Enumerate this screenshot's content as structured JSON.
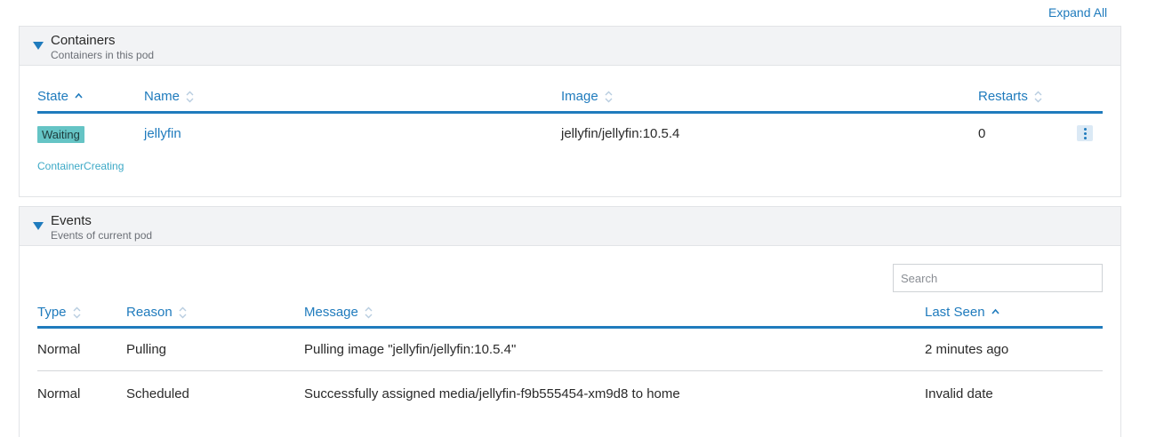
{
  "expand_all_label": "Expand All",
  "containers": {
    "title": "Containers",
    "subtitle": "Containers in this pod",
    "columns": [
      "State",
      "Name",
      "Image",
      "Restarts"
    ],
    "rows": [
      {
        "state": "Waiting",
        "state_reason": "ContainerCreating",
        "name": "jellyfin",
        "image": "jellyfin/jellyfin:10.5.4",
        "restarts": "0"
      }
    ]
  },
  "events": {
    "title": "Events",
    "subtitle": "Events of current pod",
    "search": {
      "placeholder": "Search",
      "value": ""
    },
    "columns": [
      "Type",
      "Reason",
      "Message",
      "Last Seen"
    ],
    "rows": [
      {
        "type": "Normal",
        "reason": "Pulling",
        "message": "Pulling image \"jellyfin/jellyfin:10.5.4\"",
        "last_seen": "2 minutes ago"
      },
      {
        "type": "Normal",
        "reason": "Scheduled",
        "message": "Successfully assigned media/jellyfin-f9b555454-xm9d8 to home",
        "last_seen": "Invalid date"
      }
    ]
  },
  "colors": {
    "accent": "#1f7bbd",
    "badge_waiting": "#65c4c5",
    "header_bg": "#f2f3f5"
  },
  "icons": {
    "collapse": "triangle-down-icon",
    "sort_both": "sort-icon",
    "sort_asc": "sort-asc-icon",
    "actions": "kebab-menu-icon"
  }
}
